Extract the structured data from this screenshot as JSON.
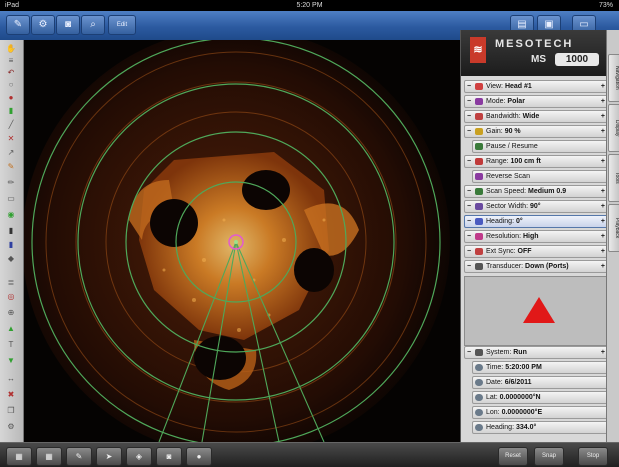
{
  "status_bar": {
    "device": "iPad",
    "time": "5:20 PM",
    "battery": "73%"
  },
  "toolbar": {
    "left_icons": [
      "wrench-icon",
      "gear-icon",
      "camera-icon",
      "magnifier-icon"
    ],
    "left_button_label": "Edit",
    "right_icons": [
      "folder-icon",
      "save-icon",
      "monitor-icon"
    ]
  },
  "sonar": {
    "overlay_label": "",
    "ring_color": "#4fa85a",
    "echo_color": "#e08a2a"
  },
  "panel": {
    "logo": {
      "brand": "MESOTECH",
      "model_prefix": "MS",
      "model_number": "1000"
    },
    "settings": [
      {
        "label": "View:",
        "value": "Head #1",
        "icon": "view-icon",
        "color": "#d04040",
        "mark": "−"
      },
      {
        "label": "Mode:",
        "value": "Polar",
        "icon": "mode-icon",
        "color": "#8a3aa0",
        "mark": "−"
      },
      {
        "label": "Bandwidth:",
        "value": "Wide",
        "icon": "bandwidth-icon",
        "color": "#c04040",
        "mark": "−"
      },
      {
        "label": "Gain:",
        "value": "90 %",
        "icon": "gain-icon",
        "color": "#c9a020",
        "mark": "−"
      },
      {
        "label": "Pause / Resume",
        "value": "",
        "icon": "pause-icon",
        "color": "#3a7a3a",
        "mark": ""
      },
      {
        "label": "Range:",
        "value": "100 cm ft",
        "icon": "range-icon",
        "color": "#c03a3a",
        "mark": "−"
      },
      {
        "label": "Reverse Scan",
        "value": "",
        "icon": "reverse-icon",
        "color": "#8a3aa0",
        "mark": ""
      },
      {
        "label": "Scan Speed:",
        "value": "Medium 0.9",
        "icon": "speed-icon",
        "color": "#3a7a3a",
        "mark": "−"
      },
      {
        "label": "Sector Width:",
        "value": "90°",
        "icon": "sector-icon",
        "color": "#6a4aa0",
        "mark": "−"
      },
      {
        "label": "Heading:",
        "value": "0°",
        "icon": "heading-icon",
        "color": "#4a5ac0",
        "mark": "−",
        "selected": true
      },
      {
        "label": "Resolution:",
        "value": "High",
        "icon": "resolution-icon",
        "color": "#c03a8a",
        "mark": "−"
      },
      {
        "label": "Ext Sync:",
        "value": "OFF",
        "icon": "sync-icon",
        "color": "#c04040",
        "mark": "−"
      },
      {
        "label": "Transducer:",
        "value": "Down (Ports)",
        "icon": "transducer-icon",
        "color": "#555555",
        "mark": "−"
      }
    ],
    "system": {
      "label": "System:",
      "value": "Run",
      "mark": "−"
    },
    "readouts": [
      {
        "label": "Time:",
        "value": "5:20:00 PM",
        "icon": "clock-icon"
      },
      {
        "label": "Date:",
        "value": "6/6/2011",
        "icon": "calendar-icon"
      },
      {
        "label": "Lat:",
        "value": "0.0000000°N",
        "icon": "globe-icon"
      },
      {
        "label": "Lon:",
        "value": "0.0000000°E",
        "icon": "globe-icon"
      },
      {
        "label": "Heading:",
        "value": "334.0°",
        "icon": "compass-icon"
      }
    ],
    "pointer_color": "#e11818"
  },
  "vtabs": [
    "Navigation",
    "Display",
    "Tools",
    "Playback"
  ],
  "bottom_bar": {
    "left_icons": [
      "grid-icon",
      "grid-icon",
      "pen-icon",
      "cursor-icon",
      "mark-icon",
      "camera-icon",
      "record-icon"
    ],
    "right_labels": [
      "Reset",
      "Snap",
      "Stop"
    ]
  }
}
